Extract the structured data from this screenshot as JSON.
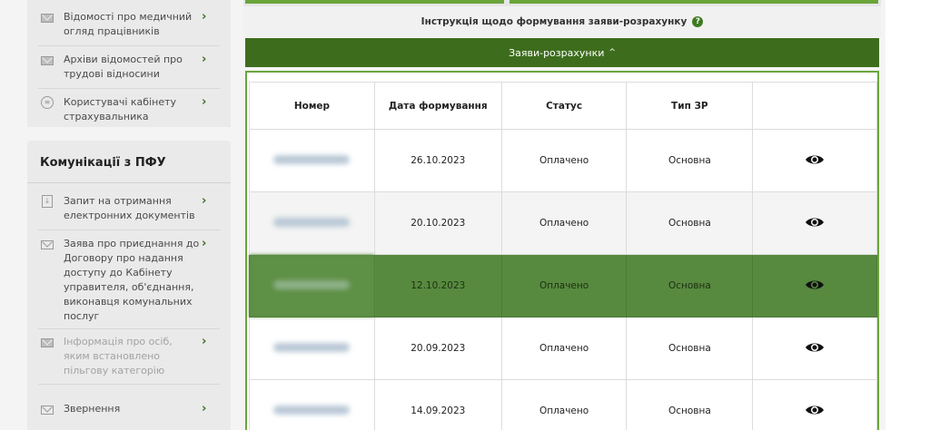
{
  "sidebar": {
    "card1": {
      "items": [
        {
          "label": "Відомості про медичний огляд працівників",
          "icon": "envelope-icon"
        },
        {
          "label": "Архіви відомостей про трудові відносини",
          "icon": "envelope-icon"
        },
        {
          "label": "Користувачі кабінету страхувальника",
          "icon": "list-circle-icon"
        }
      ]
    },
    "card2": {
      "title": "Комунікації з ПФУ",
      "items": [
        {
          "label": "Запит на отримання електронних документів",
          "icon": "document-icon",
          "disabled": false
        },
        {
          "label": "Заява про приєднання до Договору про надання доступу до Кабінету управителя, об'єднання, виконавця комунальних послуг",
          "icon": "envelope-outline-icon",
          "disabled": false
        },
        {
          "label": "Інформація про осіб, яким встановлено пільгову категорію",
          "icon": "envelope-icon",
          "disabled": true
        },
        {
          "label": "Звернення",
          "icon": "envelope-outline-icon",
          "disabled": false
        }
      ]
    },
    "chevron": "›"
  },
  "main": {
    "instruction": "Інструкція щодо формування заяви-розрахунку",
    "instruction_help_glyph": "?",
    "section_title": "Заяви-розрахунки",
    "section_chevron": "^",
    "table": {
      "headers": [
        "Номер",
        "Дата формування",
        "Статус",
        "Тип ЗР",
        ""
      ],
      "rows": [
        {
          "date": "26.10.2023",
          "status": "Оплачено",
          "type": "Основна",
          "selected": false
        },
        {
          "date": "20.10.2023",
          "status": "Оплачено",
          "type": "Основна",
          "selected": false
        },
        {
          "date": "12.10.2023",
          "status": "Оплачено",
          "type": "Основна",
          "selected": true
        },
        {
          "date": "20.09.2023",
          "status": "Оплачено",
          "type": "Основна",
          "selected": false
        },
        {
          "date": "14.09.2023",
          "status": "Оплачено",
          "type": "Основна",
          "selected": false
        }
      ]
    }
  },
  "colors": {
    "accent_dark": "#3d6d1c",
    "accent_light": "#6aa53a",
    "selected_row": "#578a3f"
  }
}
